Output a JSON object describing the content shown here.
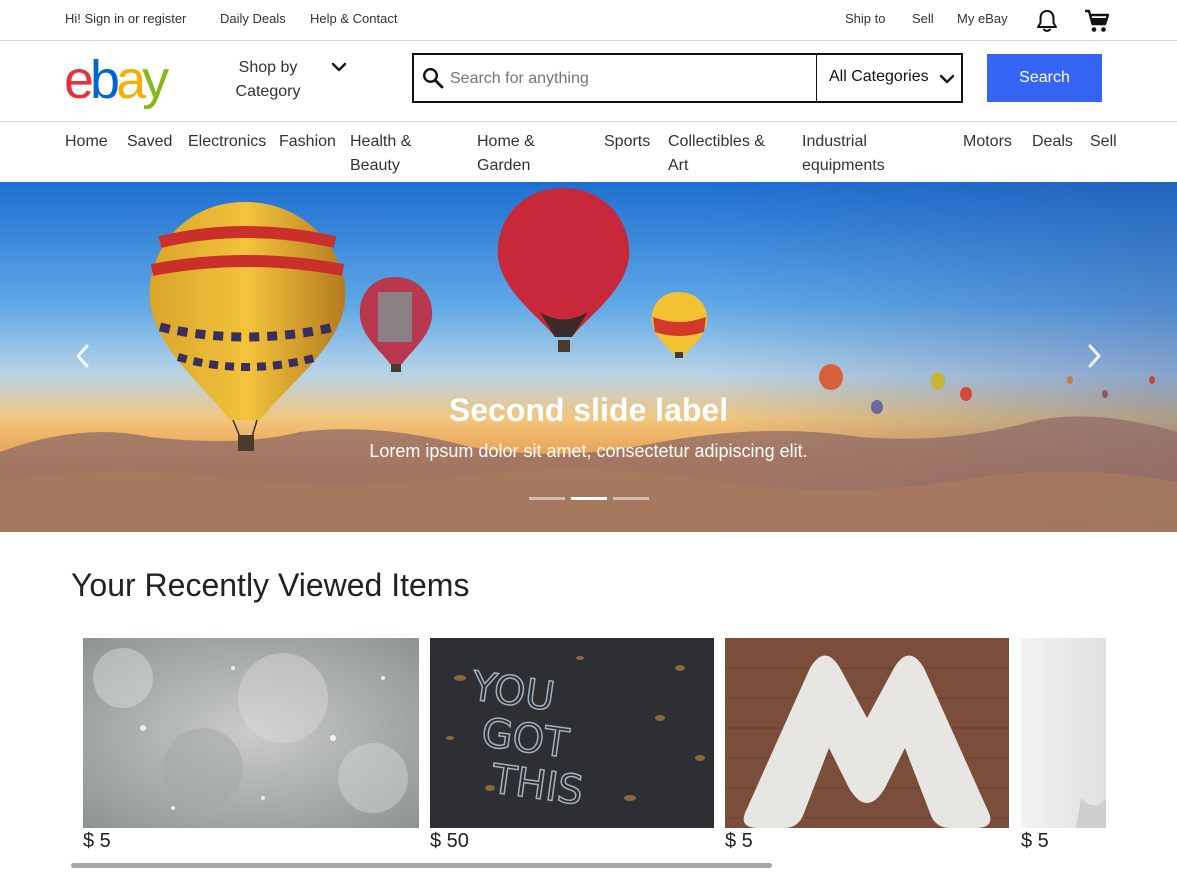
{
  "topbar": {
    "signin": "Hi! Sign in or register",
    "daily_deals": "Daily Deals",
    "help": "Help & Contact",
    "ship_to": "Ship to",
    "sell": "Sell",
    "my_ebay": "My eBay",
    "notification_icon": "bell-icon",
    "cart_icon": "cart-icon"
  },
  "header": {
    "logo_text": "ebay",
    "logo_colors": [
      "#e53238",
      "#0064d2",
      "#f5af02",
      "#86b817"
    ],
    "shop_by_category": "Shop by Category",
    "search": {
      "placeholder": "Search for anything",
      "value": "",
      "category": "All Categories",
      "button": "Search"
    },
    "accent_color": "#3665f3"
  },
  "nav": [
    "Home",
    "Saved",
    "Electronics",
    "Fashion",
    "Health & Beauty",
    "Home & Garden",
    "Sports",
    "Collectibles & Art",
    "Industrial equipments",
    "Motors",
    "Deals",
    "Sell"
  ],
  "carousel": {
    "title": "Second slide label",
    "caption": "Lorem ipsum dolor sit amet, consectetur adipiscing elit.",
    "slide_count": 3,
    "active_slide": 2
  },
  "recently_viewed": {
    "title": "Your Recently Viewed Items",
    "items": [
      {
        "price": "$ 5"
      },
      {
        "price": "$ 50"
      },
      {
        "price": "$ 5"
      },
      {
        "price": "$ 5"
      }
    ]
  }
}
